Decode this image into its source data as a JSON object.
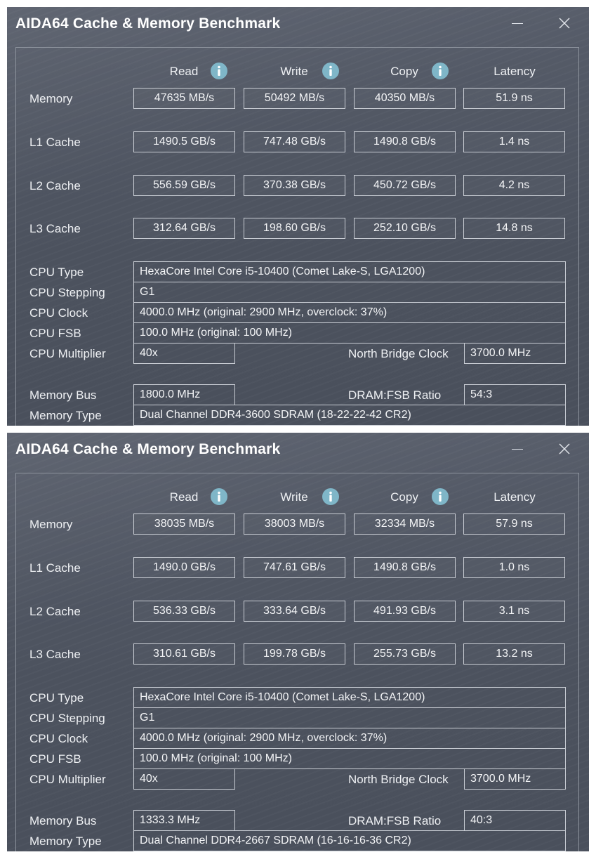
{
  "windows": [
    {
      "title": "AIDA64 Cache & Memory Benchmark",
      "headers": {
        "read": "Read",
        "write": "Write",
        "copy": "Copy",
        "latency": "Latency"
      },
      "bench_rows": [
        {
          "label": "Memory",
          "read": "47635 MB/s",
          "write": "50492 MB/s",
          "copy": "40350 MB/s",
          "latency": "51.9 ns"
        },
        {
          "label": "L1 Cache",
          "read": "1490.5 GB/s",
          "write": "747.48 GB/s",
          "copy": "1490.8 GB/s",
          "latency": "1.4 ns"
        },
        {
          "label": "L2 Cache",
          "read": "556.59 GB/s",
          "write": "370.38 GB/s",
          "copy": "450.72 GB/s",
          "latency": "4.2 ns"
        },
        {
          "label": "L3 Cache",
          "read": "312.64 GB/s",
          "write": "198.60 GB/s",
          "copy": "252.10 GB/s",
          "latency": "14.8 ns"
        }
      ],
      "cpu_type": {
        "label": "CPU Type",
        "value": "HexaCore Intel Core i5-10400  (Comet Lake-S, LGA1200)"
      },
      "cpu_stepping": {
        "label": "CPU Stepping",
        "value": "G1"
      },
      "cpu_clock": {
        "label": "CPU Clock",
        "value": "4000.0 MHz  (original: 2900 MHz, overclock: 37%)"
      },
      "cpu_fsb": {
        "label": "CPU FSB",
        "value": "100.0 MHz  (original: 100 MHz)"
      },
      "cpu_multiplier": {
        "label": "CPU Multiplier",
        "value": "40x"
      },
      "north_bridge": {
        "label": "North Bridge Clock",
        "value": "3700.0 MHz"
      },
      "memory_bus": {
        "label": "Memory Bus",
        "value": "1800.0 MHz"
      },
      "dram_fsb": {
        "label": "DRAM:FSB Ratio",
        "value": "54:3"
      },
      "memory_type": {
        "label": "Memory Type",
        "value": "Dual Channel DDR4-3600 SDRAM  (18-22-22-42 CR2)"
      }
    },
    {
      "title": "AIDA64 Cache & Memory Benchmark",
      "headers": {
        "read": "Read",
        "write": "Write",
        "copy": "Copy",
        "latency": "Latency"
      },
      "bench_rows": [
        {
          "label": "Memory",
          "read": "38035 MB/s",
          "write": "38003 MB/s",
          "copy": "32334 MB/s",
          "latency": "57.9 ns"
        },
        {
          "label": "L1 Cache",
          "read": "1490.0 GB/s",
          "write": "747.61 GB/s",
          "copy": "1490.8 GB/s",
          "latency": "1.0 ns"
        },
        {
          "label": "L2 Cache",
          "read": "536.33 GB/s",
          "write": "333.64 GB/s",
          "copy": "491.93 GB/s",
          "latency": "3.1 ns"
        },
        {
          "label": "L3 Cache",
          "read": "310.61 GB/s",
          "write": "199.78 GB/s",
          "copy": "255.73 GB/s",
          "latency": "13.2 ns"
        }
      ],
      "cpu_type": {
        "label": "CPU Type",
        "value": "HexaCore Intel Core i5-10400  (Comet Lake-S, LGA1200)"
      },
      "cpu_stepping": {
        "label": "CPU Stepping",
        "value": "G1"
      },
      "cpu_clock": {
        "label": "CPU Clock",
        "value": "4000.0 MHz  (original: 2900 MHz, overclock: 37%)"
      },
      "cpu_fsb": {
        "label": "CPU FSB",
        "value": "100.0 MHz  (original: 100 MHz)"
      },
      "cpu_multiplier": {
        "label": "CPU Multiplier",
        "value": "40x"
      },
      "north_bridge": {
        "label": "North Bridge Clock",
        "value": "3700.0 MHz"
      },
      "memory_bus": {
        "label": "Memory Bus",
        "value": "1333.3 MHz"
      },
      "dram_fsb": {
        "label": "DRAM:FSB Ratio",
        "value": "40:3"
      },
      "memory_type": {
        "label": "Memory Type",
        "value": "Dual Channel DDR4-2667 SDRAM  (16-16-16-36 CR2)"
      }
    }
  ],
  "icons": {
    "info": "info-circle-icon",
    "minimize": "minimize-icon",
    "close": "close-icon"
  },
  "colors": {
    "window_bg": "#4f5562",
    "info_icon": "#7fb6c8",
    "text": "#eef0f3",
    "box_border": "#c9cdd4"
  }
}
